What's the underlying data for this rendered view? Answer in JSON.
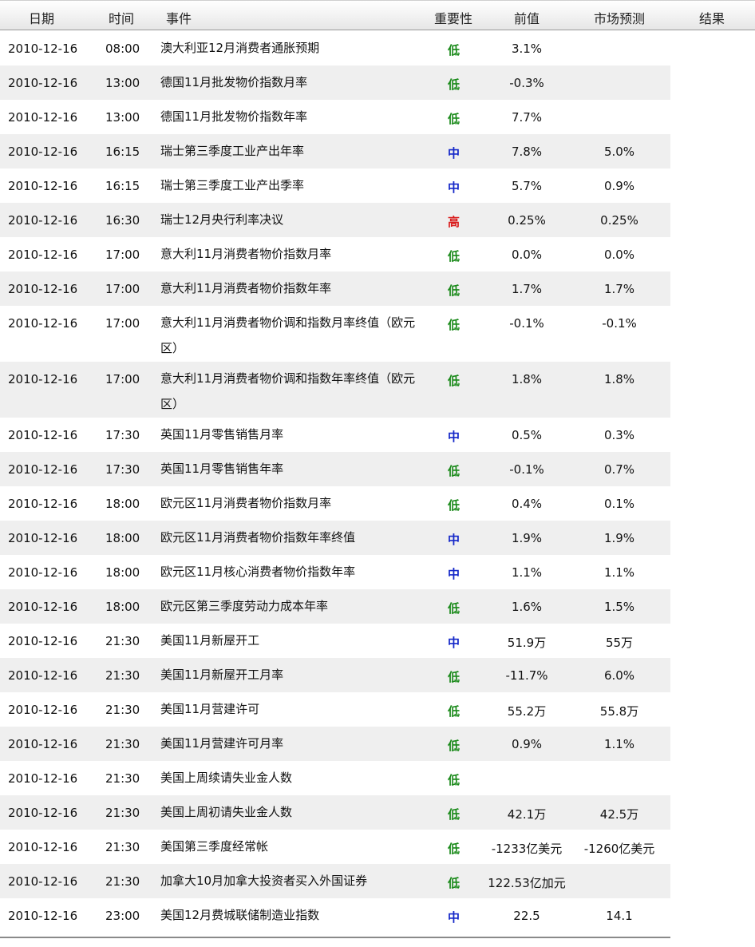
{
  "headers": {
    "date": "日期",
    "time": "时间",
    "event": "事件",
    "importance": "重要性",
    "previous": "前值",
    "forecast": "市场预测",
    "result": "结果"
  },
  "rows": [
    {
      "date": "2010-12-16",
      "time": "08:00",
      "event": "澳大利亚12月消费者通胀预期",
      "importance": "低",
      "previous": "3.1%",
      "forecast": ""
    },
    {
      "date": "2010-12-16",
      "time": "13:00",
      "event": "德国11月批发物价指数月率",
      "importance": "低",
      "previous": "-0.3%",
      "forecast": ""
    },
    {
      "date": "2010-12-16",
      "time": "13:00",
      "event": "德国11月批发物价指数年率",
      "importance": "低",
      "previous": "7.7%",
      "forecast": ""
    },
    {
      "date": "2010-12-16",
      "time": "16:15",
      "event": "瑞士第三季度工业产出年率",
      "importance": "中",
      "previous": "7.8%",
      "forecast": "5.0%"
    },
    {
      "date": "2010-12-16",
      "time": "16:15",
      "event": "瑞士第三季度工业产出季率",
      "importance": "中",
      "previous": "5.7%",
      "forecast": "0.9%"
    },
    {
      "date": "2010-12-16",
      "time": "16:30",
      "event": "瑞士12月央行利率决议",
      "importance": "高",
      "previous": "0.25%",
      "forecast": "0.25%"
    },
    {
      "date": "2010-12-16",
      "time": "17:00",
      "event": "意大利11月消费者物价指数月率",
      "importance": "低",
      "previous": "0.0%",
      "forecast": "0.0%"
    },
    {
      "date": "2010-12-16",
      "time": "17:00",
      "event": "意大利11月消费者物价指数年率",
      "importance": "低",
      "previous": "1.7%",
      "forecast": "1.7%"
    },
    {
      "date": "2010-12-16",
      "time": "17:00",
      "event": "意大利11月消费者物价调和指数月率终值（欧元区）",
      "importance": "低",
      "previous": "-0.1%",
      "forecast": "-0.1%"
    },
    {
      "date": "2010-12-16",
      "time": "17:00",
      "event": "意大利11月消费者物价调和指数年率终值（欧元区）",
      "importance": "低",
      "previous": "1.8%",
      "forecast": "1.8%"
    },
    {
      "date": "2010-12-16",
      "time": "17:30",
      "event": "英国11月零售销售月率",
      "importance": "中",
      "previous": "0.5%",
      "forecast": "0.3%"
    },
    {
      "date": "2010-12-16",
      "time": "17:30",
      "event": "英国11月零售销售年率",
      "importance": "低",
      "previous": "-0.1%",
      "forecast": "0.7%"
    },
    {
      "date": "2010-12-16",
      "time": "18:00",
      "event": "欧元区11月消费者物价指数月率",
      "importance": "低",
      "previous": "0.4%",
      "forecast": "0.1%"
    },
    {
      "date": "2010-12-16",
      "time": "18:00",
      "event": "欧元区11月消费者物价指数年率终值",
      "importance": "中",
      "previous": "1.9%",
      "forecast": "1.9%"
    },
    {
      "date": "2010-12-16",
      "time": "18:00",
      "event": "欧元区11月核心消费者物价指数年率",
      "importance": "中",
      "previous": "1.1%",
      "forecast": "1.1%"
    },
    {
      "date": "2010-12-16",
      "time": "18:00",
      "event": "欧元区第三季度劳动力成本年率",
      "importance": "低",
      "previous": "1.6%",
      "forecast": "1.5%"
    },
    {
      "date": "2010-12-16",
      "time": "21:30",
      "event": "美国11月新屋开工",
      "importance": "中",
      "previous": "51.9万",
      "forecast": "55万"
    },
    {
      "date": "2010-12-16",
      "time": "21:30",
      "event": "美国11月新屋开工月率",
      "importance": "低",
      "previous": "-11.7%",
      "forecast": "6.0%"
    },
    {
      "date": "2010-12-16",
      "time": "21:30",
      "event": "美国11月营建许可",
      "importance": "低",
      "previous": "55.2万",
      "forecast": "55.8万"
    },
    {
      "date": "2010-12-16",
      "time": "21:30",
      "event": "美国11月营建许可月率",
      "importance": "低",
      "previous": "0.9%",
      "forecast": "1.1%"
    },
    {
      "date": "2010-12-16",
      "time": "21:30",
      "event": "美国上周续请失业金人数",
      "importance": "低",
      "previous": "",
      "forecast": ""
    },
    {
      "date": "2010-12-16",
      "time": "21:30",
      "event": "美国上周初请失业金人数",
      "importance": "低",
      "previous": "42.1万",
      "forecast": "42.5万"
    },
    {
      "date": "2010-12-16",
      "time": "21:30",
      "event": "美国第三季度经常帐",
      "importance": "低",
      "previous": "-1233亿美元",
      "forecast": "-1260亿美元"
    },
    {
      "date": "2010-12-16",
      "time": "21:30",
      "event": "加拿大10月加拿大投资者买入外国证券",
      "importance": "低",
      "previous": "122.53亿加元",
      "forecast": ""
    },
    {
      "date": "2010-12-16",
      "time": "23:00",
      "event": "美国12月费城联储制造业指数",
      "importance": "中",
      "previous": "22.5",
      "forecast": "14.1"
    }
  ]
}
